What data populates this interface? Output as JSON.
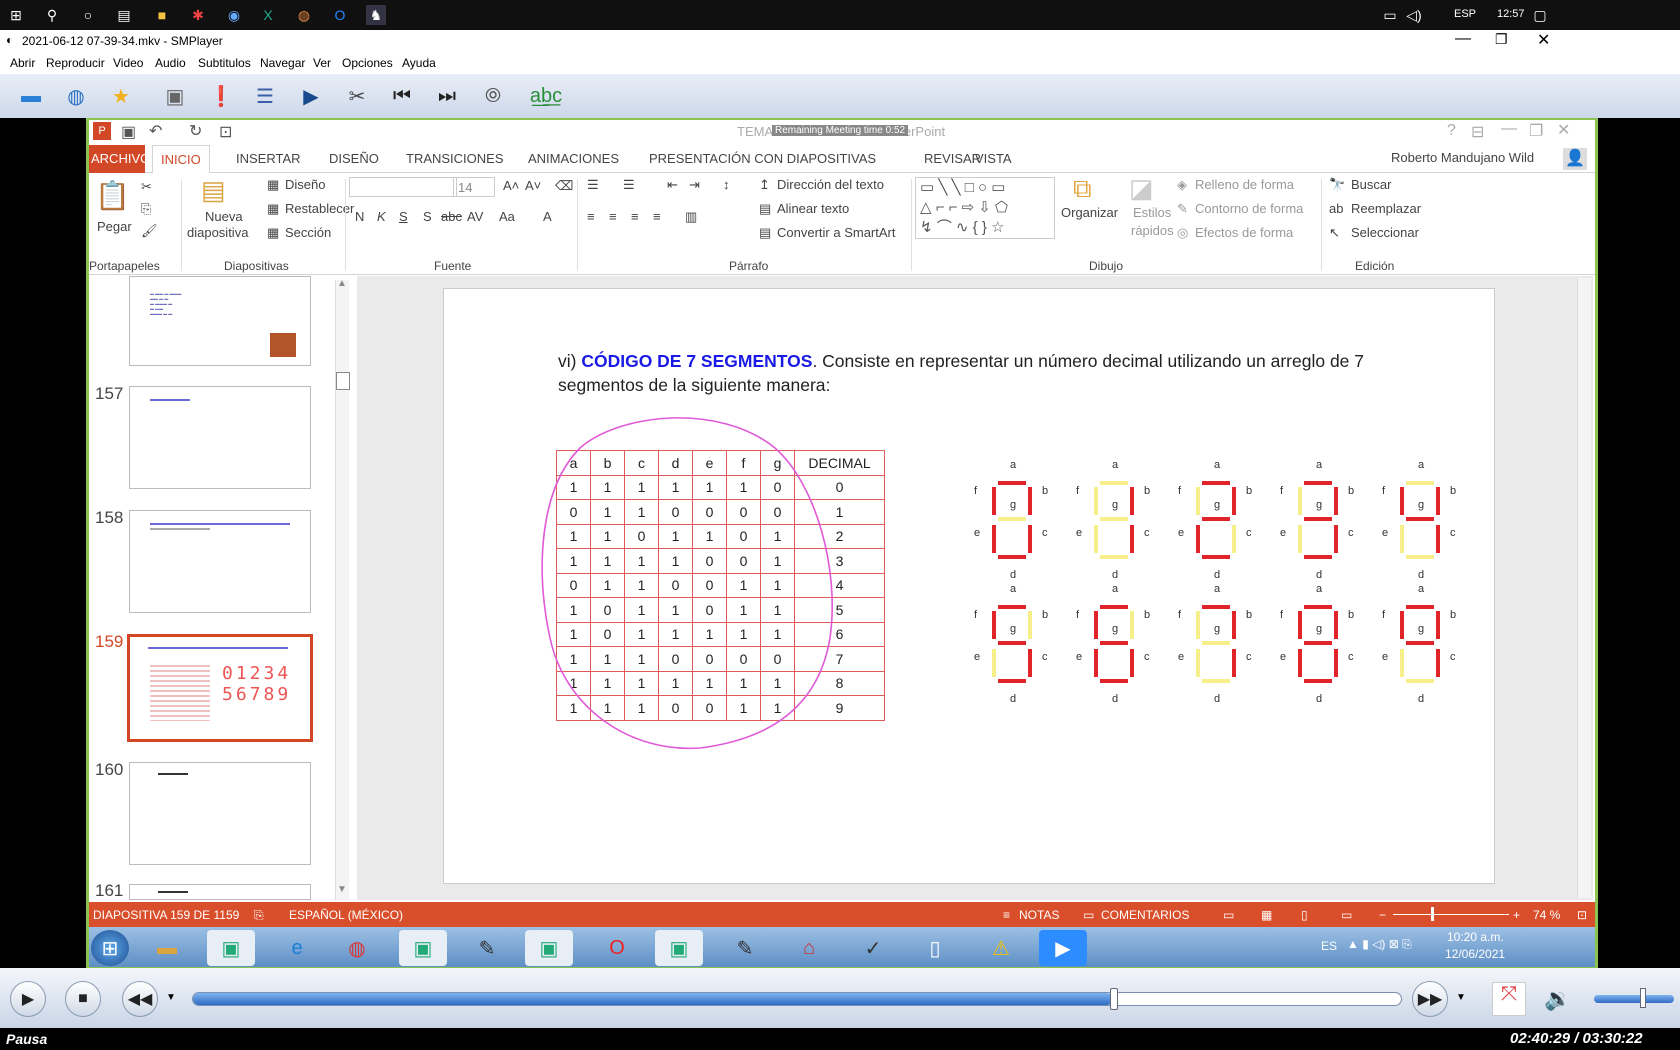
{
  "taskbar": {
    "lang": "ESP",
    "time": "12:57"
  },
  "player": {
    "title": "2021-06-12 07-39-34.mkv - SMPlayer",
    "menu": [
      "Abrir",
      "Reproducir",
      "Video",
      "Audio",
      "Subtitulos",
      "Navegar",
      "Ver",
      "Opciones",
      "Ayuda"
    ],
    "status": "Pausa",
    "time": "02:40:29 / 03:30:22",
    "progress": 0.762
  },
  "ppt": {
    "title": "TEMA 1 - 3 - Sistemas - PowerPoint",
    "meeting": "Remaining Meeting time 0:52",
    "tabs": [
      "ARCHIVO",
      "INICIO",
      "INSERTAR",
      "DISEÑO",
      "TRANSICIONES",
      "ANIMACIONES",
      "PRESENTACIÓN CON DIAPOSITIVAS",
      "REVISAR",
      "VISTA"
    ],
    "user": "Roberto Mandujano Wild",
    "ribbon": {
      "pegar": "Pegar",
      "portapapeles": "Portapapeles",
      "nueva": "Nueva",
      "diapositiva": "diapositiva",
      "diseno": "Diseño",
      "restablecer": "Restablecer",
      "seccion": "Sección",
      "diapositivas": "Diapositivas",
      "fontsize": "14",
      "fuente": "Fuente",
      "dir": "Dirección del texto",
      "alinear": "Alinear texto",
      "smartart": "Convertir a SmartArt",
      "parrafo": "Párrafo",
      "organizar": "Organizar",
      "estilos": "Estilos",
      "rapidos": "rápidos",
      "relleno": "Relleno de forma",
      "contorno": "Contorno de forma",
      "efectos": "Efectos de forma",
      "dibujo": "Dibujo",
      "buscar": "Buscar",
      "reemplazar": "Reemplazar",
      "seleccionar": "Seleccionar",
      "edicion": "Edición",
      "fmt": [
        "N",
        "K",
        "S",
        "S",
        "abc",
        "AV",
        "Aa",
        "A"
      ]
    },
    "thumbs": [
      "157",
      "158",
      "159",
      "160",
      "161"
    ],
    "statusbar": {
      "slide": "DIAPOSITIVA 159 DE 1159",
      "lang": "ESPAÑOL (MÉXICO)",
      "notas": "NOTAS",
      "comentarios": "COMENTARIOS",
      "zoom": "74 %"
    },
    "w7": {
      "lang": "ES",
      "time": "10:20 a.m.",
      "date": "12/06/2021"
    }
  },
  "slide": {
    "prefix": "vi) ",
    "heading": "CÓDIGO DE 7 SEGMENTOS",
    "text": ". Consiste en representar un número decimal utilizando un arreglo de 7",
    "text2": "segmentos de la siguiente manera:",
    "headers": [
      "a",
      "b",
      "c",
      "d",
      "e",
      "f",
      "g",
      "DECIMAL"
    ],
    "rows": [
      [
        "1",
        "1",
        "1",
        "1",
        "1",
        "1",
        "0",
        "0"
      ],
      [
        "0",
        "1",
        "1",
        "0",
        "0",
        "0",
        "0",
        "1"
      ],
      [
        "1",
        "1",
        "0",
        "1",
        "1",
        "0",
        "1",
        "2"
      ],
      [
        "1",
        "1",
        "1",
        "1",
        "0",
        "0",
        "1",
        "3"
      ],
      [
        "0",
        "1",
        "1",
        "0",
        "0",
        "1",
        "1",
        "4"
      ],
      [
        "1",
        "0",
        "1",
        "1",
        "0",
        "1",
        "1",
        "5"
      ],
      [
        "1",
        "0",
        "1",
        "1",
        "1",
        "1",
        "1",
        "6"
      ],
      [
        "1",
        "1",
        "1",
        "0",
        "0",
        "0",
        "0",
        "7"
      ],
      [
        "1",
        "1",
        "1",
        "1",
        "1",
        "1",
        "1",
        "8"
      ],
      [
        "1",
        "1",
        "1",
        "0",
        "0",
        "1",
        "1",
        "9"
      ]
    ],
    "labels": {
      "a": "a",
      "b": "b",
      "c": "c",
      "d": "d",
      "e": "e",
      "f": "f",
      "g": "g"
    }
  }
}
